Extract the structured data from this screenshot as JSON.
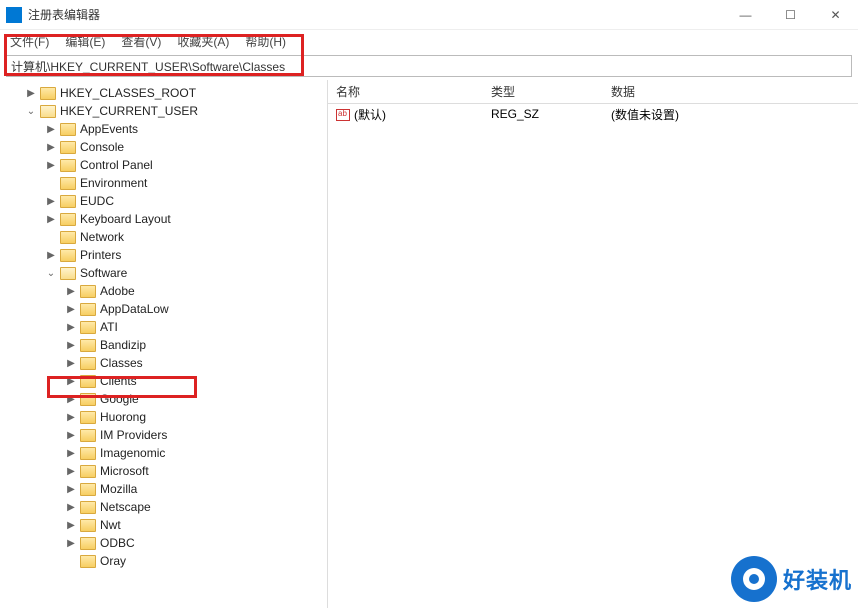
{
  "window": {
    "title": "注册表编辑器"
  },
  "menu": {
    "file": "文件(F)",
    "edit": "编辑(E)",
    "view": "查看(V)",
    "favorites": "收藏夹(A)",
    "help": "帮助(H)"
  },
  "path": "计算机\\HKEY_CURRENT_USER\\Software\\Classes",
  "tree": {
    "root0": "HKEY_CLASSES_ROOT",
    "root1": "HKEY_CURRENT_USER",
    "cu": {
      "n0": "AppEvents",
      "n1": "Console",
      "n2": "Control Panel",
      "n3": "Environment",
      "n4": "EUDC",
      "n5": "Keyboard Layout",
      "n6": "Network",
      "n7": "Printers",
      "n8": "Software",
      "sw": {
        "s0": "Adobe",
        "s1": "AppDataLow",
        "s2": "ATI",
        "s3": "Bandizip",
        "s4": "Classes",
        "s5": "Clients",
        "s6": "Google",
        "s7": "Huorong",
        "s8": "IM Providers",
        "s9": "Imagenomic",
        "s10": "Microsoft",
        "s11": "Mozilla",
        "s12": "Netscape",
        "s13": "Nwt",
        "s14": "ODBC",
        "s15": "Oray"
      }
    }
  },
  "list": {
    "headers": {
      "name": "名称",
      "type": "类型",
      "data": "数据"
    },
    "row0": {
      "name": "(默认)",
      "type": "REG_SZ",
      "data": "(数值未设置)"
    }
  },
  "watermark": "好装机"
}
